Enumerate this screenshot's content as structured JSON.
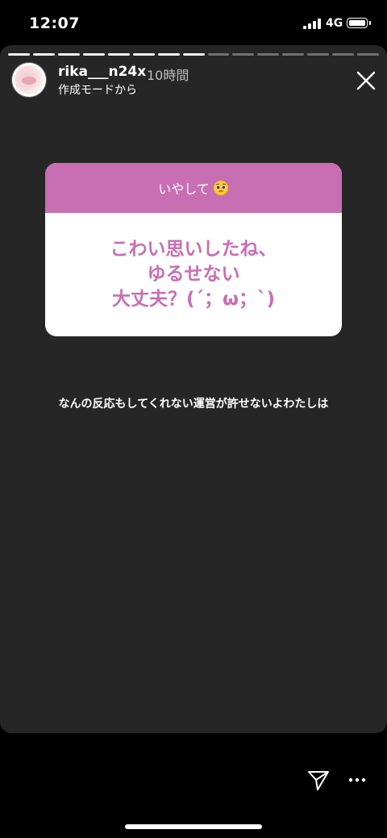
{
  "status_bar": {
    "time": "12:07",
    "network": "4G"
  },
  "story": {
    "segments_total": 15,
    "segments_viewed": 8,
    "username": "rika___n24x",
    "time_ago": "10時間",
    "subtitle": "作成モードから",
    "question": {
      "prompt": "いやして",
      "prompt_emoji": "pleading-face-emoji",
      "header_color": "#c76fb2",
      "answer_lines": [
        "こわい思いしたね、",
        "ゆるせない",
        "大丈夫？(´；ω；`)"
      ]
    },
    "reply_text": "なんの反応もしてくれない運営が許せないよわたしは"
  },
  "icons": {
    "close": "close-icon",
    "share": "send-icon",
    "more": "more-icon"
  },
  "colors": {
    "accent": "#c76fb2",
    "story_bg": "#262626"
  }
}
